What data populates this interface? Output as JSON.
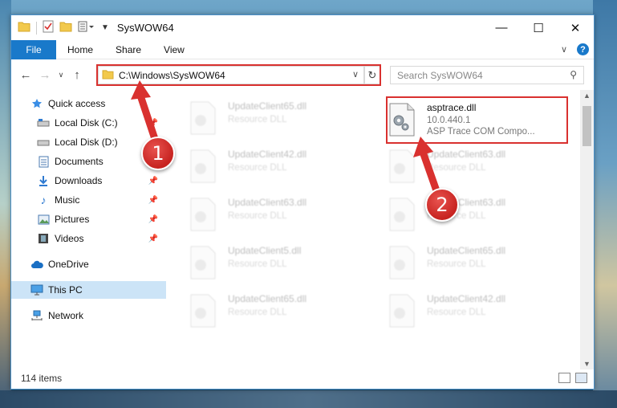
{
  "window": {
    "title": "SysWOW64"
  },
  "ribbon": {
    "tabs": [
      "File",
      "Home",
      "Share",
      "View"
    ],
    "help": "?"
  },
  "address": {
    "path": "C:\\Windows\\SysWOW64"
  },
  "search": {
    "placeholder": "Search SysWOW64"
  },
  "sidebar": {
    "items": [
      {
        "label": "Quick access",
        "icon": "star-icon"
      },
      {
        "label": "Local Disk (C:)",
        "icon": "drive-icon",
        "pinned": true
      },
      {
        "label": "Local Disk (D:)",
        "icon": "drive-icon"
      },
      {
        "label": "Documents",
        "icon": "documents-icon"
      },
      {
        "label": "Downloads",
        "icon": "download-icon",
        "pinned": true
      },
      {
        "label": "Music",
        "icon": "music-icon",
        "pinned": true
      },
      {
        "label": "Pictures",
        "icon": "pictures-icon",
        "pinned": true
      },
      {
        "label": "Videos",
        "icon": "videos-icon",
        "pinned": true
      },
      {
        "label": "OneDrive",
        "icon": "cloud-icon"
      },
      {
        "label": "This PC",
        "icon": "computer-icon",
        "selected": true
      },
      {
        "label": "Network",
        "icon": "network-icon"
      }
    ]
  },
  "files": {
    "highlighted": {
      "name": "asptrace.dll",
      "version": "10.0.440.1",
      "description": "ASP Trace COM Compo..."
    },
    "blurred": [
      {
        "name": "UpdateClient65.dll",
        "type": "Resource DLL"
      },
      {
        "name": "UpdateClient42.dll",
        "type": "Resource DLL"
      },
      {
        "name": "UpdateClient63.dll",
        "type": "Resource DLL"
      },
      {
        "name": "UpdateClient5.dll",
        "type": "Resource DLL"
      },
      {
        "name": "UpdateClient65.dll",
        "type": "Resource DLL"
      },
      {
        "name": "UpdateClient63.dll",
        "type": "Resource DLL"
      },
      {
        "name": "UpdateClient63.dll",
        "type": "Resource DLL"
      },
      {
        "name": "UpdateClient65.dll",
        "type": "Resource DLL"
      },
      {
        "name": "UpdateClient42.dll",
        "type": "Resource DLL"
      }
    ]
  },
  "status": {
    "items": "114 items"
  },
  "callouts": {
    "one": "1",
    "two": "2"
  },
  "colors": {
    "accent": "#1979ca",
    "highlight": "#d9312f",
    "selection": "#cce4f7"
  }
}
